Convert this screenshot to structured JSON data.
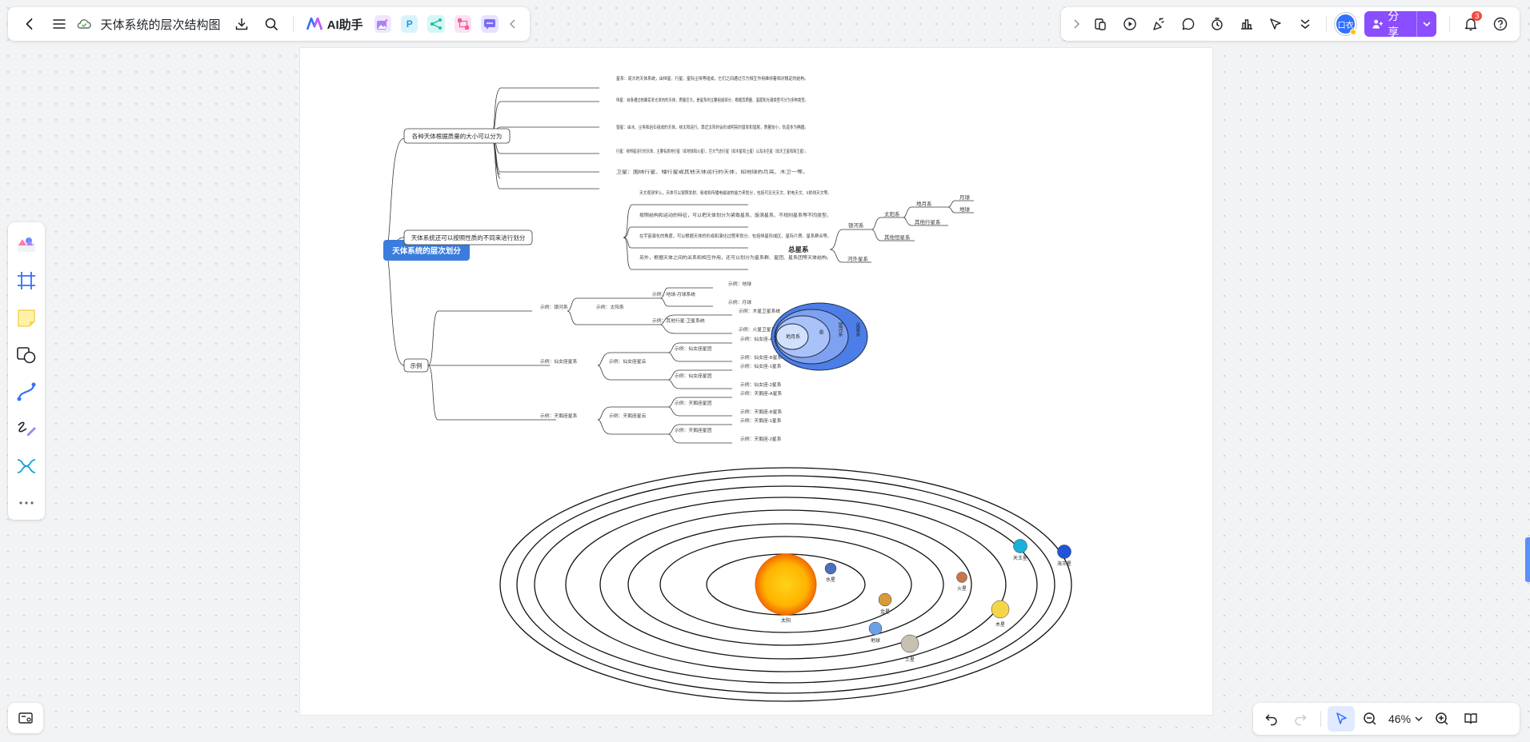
{
  "topbar": {
    "title": "天体系统的层次结构图",
    "ai_label": "AI助手",
    "apps": [
      "P"
    ],
    "share_label": "分享",
    "avatar_text": "口衣",
    "notification_count": "3"
  },
  "zoom": {
    "level": "46%"
  },
  "mindmap": {
    "root": "天体系统的层次划分",
    "branch1": {
      "label": "各种天体根据质量的大小可以分为",
      "items": [
        "星系：庞大的天体系统，由恒星、行星、星际尘埃等组成，它们之间通过引力相互作用维持着相对稳定的结构。",
        "恒星：自身通过核聚变发光发热的天体，质量巨大，是星系的主要组成部分，根据其质量、温度和光谱类型可分为多种类型。",
        "彗星：由冰、尘埃和岩石组成的天体，绕太阳运行，靠近太阳时会形成明亮的彗发和彗尾，质量较小，轨道多为椭圆。",
        "行星：绕恒星运行的天体，主要有类地行星（如地球和火星）、巨大气态行星（如木星和土星）以及冰巨星（如天王星和海王星）。",
        "卫星：围绕行星、矮行星或其他天体运行的天体，如地球的月亮、木卫一等。"
      ]
    },
    "branch2": {
      "label": "天体系统还可以按照性质的不同来进行划分",
      "items": [
        "天文观测学上，天体可以按照发射、吸收和传播电磁波的能力来划分，包括可见光天文、射电天文、X射线天文等。",
        "按照结构和运动的特征，可以把天体划分为紧致星系、旋涡星系、不规则星系等不同类型。",
        "在宇宙演化的角度，可以根据天体的形成和演化过程来划分，包括恒星形成区、星际介质、星系群合等。",
        "另外，根据天体之间的关系和相互作用，还可以划分为星系群、星团、星系团等天体结构。"
      ]
    },
    "branch3": {
      "label": "示例",
      "groups": [
        {
          "label": "示例：银河系",
          "sub": "示例：太阳系",
          "leaves": [
            {
              "label": "示例：地球-月球系统",
              "items": [
                "示例：地球",
                "示例：月球"
              ]
            },
            {
              "label": "示例：其他行星-卫星系统",
              "items": [
                "示例：木星卫星系统",
                "示例：火星卫星系统"
              ]
            }
          ]
        },
        {
          "label": "示例：仙女座星系",
          "sub": "示例：仙女座星云",
          "leaves": [
            {
              "label": "示例：仙女座星团",
              "items": [
                "示例：仙女座-A星系",
                "示例：仙女座-B星系"
              ]
            },
            {
              "label": "示例：仙女座星团",
              "items": [
                "示例：仙女座-1星系",
                "示例：仙女座-2星系"
              ]
            }
          ]
        },
        {
          "label": "示例：天鹅座星系",
          "sub": "示例：天鹅座星云",
          "leaves": [
            {
              "label": "示例：天鹅座星团",
              "items": [
                "示例：天鹅座-A星系",
                "示例：天鹅座-B星系"
              ]
            },
            {
              "label": "示例：天鹅座星团",
              "items": [
                "示例：天鹅座-1星系",
                "示例：天鹅座-2星系"
              ]
            }
          ]
        }
      ]
    }
  },
  "hierarchy": {
    "root": "总星系",
    "galaxy": "银河系",
    "solar": "太阳系",
    "earth_moon": "地月系",
    "moon": "月球",
    "earth": "地球",
    "other_planets": "其他行星系",
    "other_stars": "其他恒星系",
    "extragalactic": "河外星系"
  },
  "nested": {
    "earth_moon": "地月系",
    "solar": "太阳系",
    "galaxy": "银河系",
    "total": "总星系"
  },
  "solar_system": {
    "sun": "太阳",
    "planets": [
      "水星",
      "金星",
      "地球",
      "火星",
      "木星",
      "土星",
      "天王星",
      "海王星"
    ]
  }
}
